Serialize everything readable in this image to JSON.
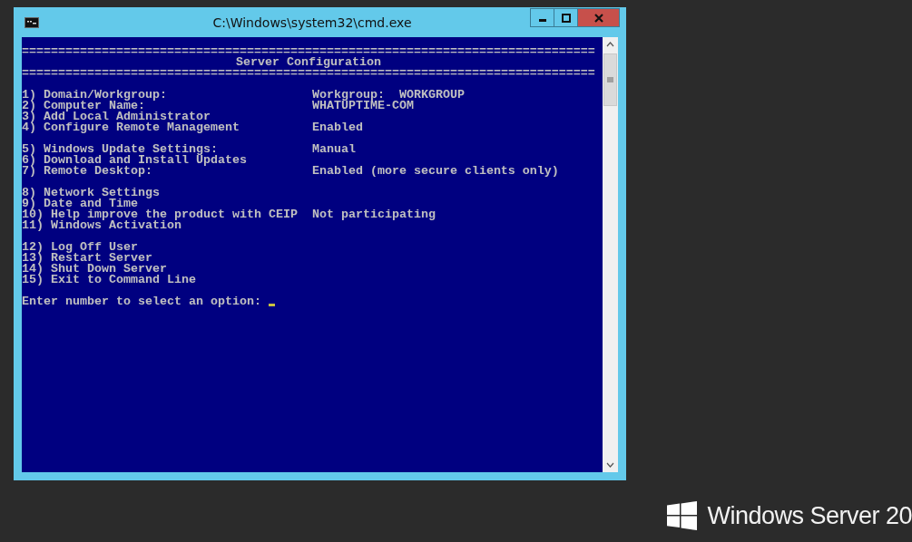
{
  "window": {
    "title": "C:\\Windows\\system32\\cmd.exe"
  },
  "console": {
    "lines": [
      {
        "kind": "separator",
        "text": "==============================================================================="
      },
      {
        "kind": "title",
        "text": "Server Configuration"
      },
      {
        "kind": "separator",
        "text": "==============================================================================="
      },
      {
        "kind": "blank"
      },
      {
        "kind": "item",
        "text": "1) Domain/Workgroup:",
        "value": "Workgroup:  WORKGROUP"
      },
      {
        "kind": "item",
        "text": "2) Computer Name:",
        "value": "WHATUPTIME-COM"
      },
      {
        "kind": "item",
        "text": "3) Add Local Administrator"
      },
      {
        "kind": "item",
        "text": "4) Configure Remote Management",
        "value": "Enabled"
      },
      {
        "kind": "blank"
      },
      {
        "kind": "item",
        "text": "5) Windows Update Settings:",
        "value": "Manual"
      },
      {
        "kind": "item",
        "text": "6) Download and Install Updates"
      },
      {
        "kind": "item",
        "text": "7) Remote Desktop:",
        "value": "Enabled (more secure clients only)"
      },
      {
        "kind": "blank"
      },
      {
        "kind": "item",
        "text": "8) Network Settings"
      },
      {
        "kind": "item",
        "text": "9) Date and Time"
      },
      {
        "kind": "item",
        "text": "10) Help improve the product with CEIP",
        "value": "Not participating"
      },
      {
        "kind": "item",
        "text": "11) Windows Activation"
      },
      {
        "kind": "blank"
      },
      {
        "kind": "item",
        "text": "12) Log Off User"
      },
      {
        "kind": "item",
        "text": "13) Restart Server"
      },
      {
        "kind": "item",
        "text": "14) Shut Down Server"
      },
      {
        "kind": "item",
        "text": "15) Exit to Command Line"
      },
      {
        "kind": "blank"
      },
      {
        "kind": "prompt",
        "text": "Enter number to select an option:"
      }
    ]
  },
  "brand": {
    "text": "Windows Server 20"
  }
}
